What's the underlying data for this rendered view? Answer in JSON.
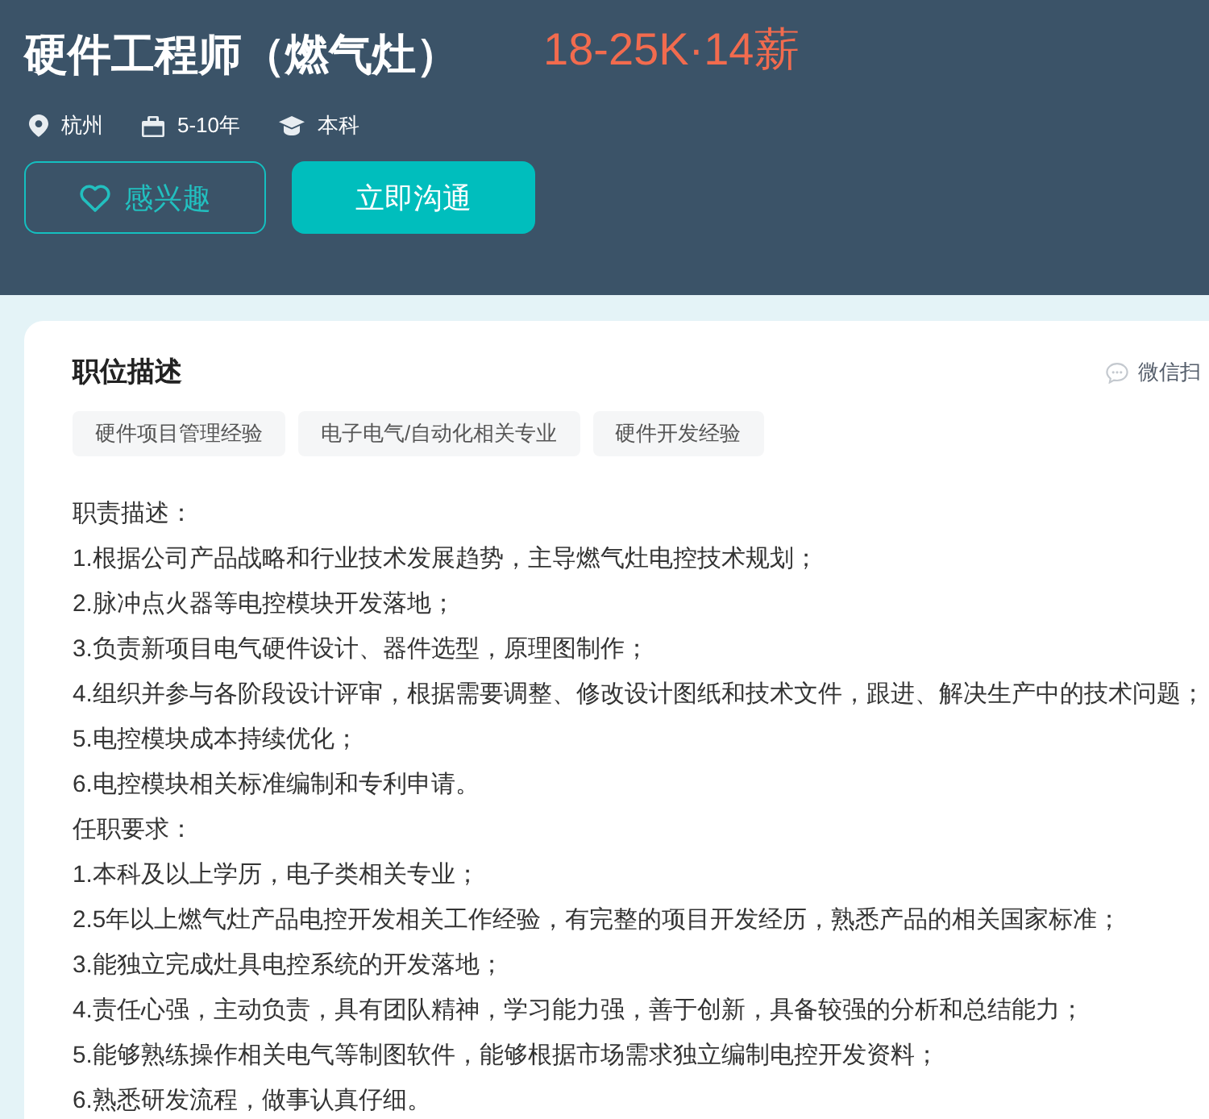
{
  "header": {
    "title": "硬件工程师（燃气灶）",
    "salary": "18-25K·14薪",
    "meta": [
      {
        "kind": "location",
        "text": "杭州"
      },
      {
        "kind": "experience",
        "text": "5-10年"
      },
      {
        "kind": "degree",
        "text": "本科"
      }
    ],
    "buttons": [
      {
        "kind": "outline",
        "label": "感兴趣"
      },
      {
        "kind": "primary",
        "label": "立即沟通"
      }
    ]
  },
  "card": {
    "title": "职位描述",
    "share": "微信扫",
    "tags": [
      "硬件项目管理经验",
      "电子电气/自动化相关专业",
      "硬件开发经验"
    ],
    "description": [
      "职责描述：",
      "1.根据公司产品战略和行业技术发展趋势，主导燃气灶电控技术规划；",
      "2.脉冲点火器等电控模块开发落地；",
      "3.负责新项目电气硬件设计、器件选型，原理图制作；",
      "4.组织并参与各阶段设计评审，根据需要调整、修改设计图纸和技术文件，跟进、解决生产中的技术问题；",
      "5.电控模块成本持续优化；",
      "6.电控模块相关标准编制和专利申请。",
      "任职要求：",
      "1.本科及以上学历，电子类相关专业；",
      "2.5年以上燃气灶产品电控开发相关工作经验，有完整的项目开发经历，熟悉产品的相关国家标准；",
      "3.能独立完成灶具电控系统的开发落地；",
      "4.责任心强，主动负责，具有团队精神，学习能力强，善于创新，具备较强的分析和总结能力；",
      "5.能够熟练操作相关电气等制图软件，能够根据市场需求独立编制电控开发资料；",
      "6.熟悉研发流程，做事认真仔细。"
    ]
  }
}
